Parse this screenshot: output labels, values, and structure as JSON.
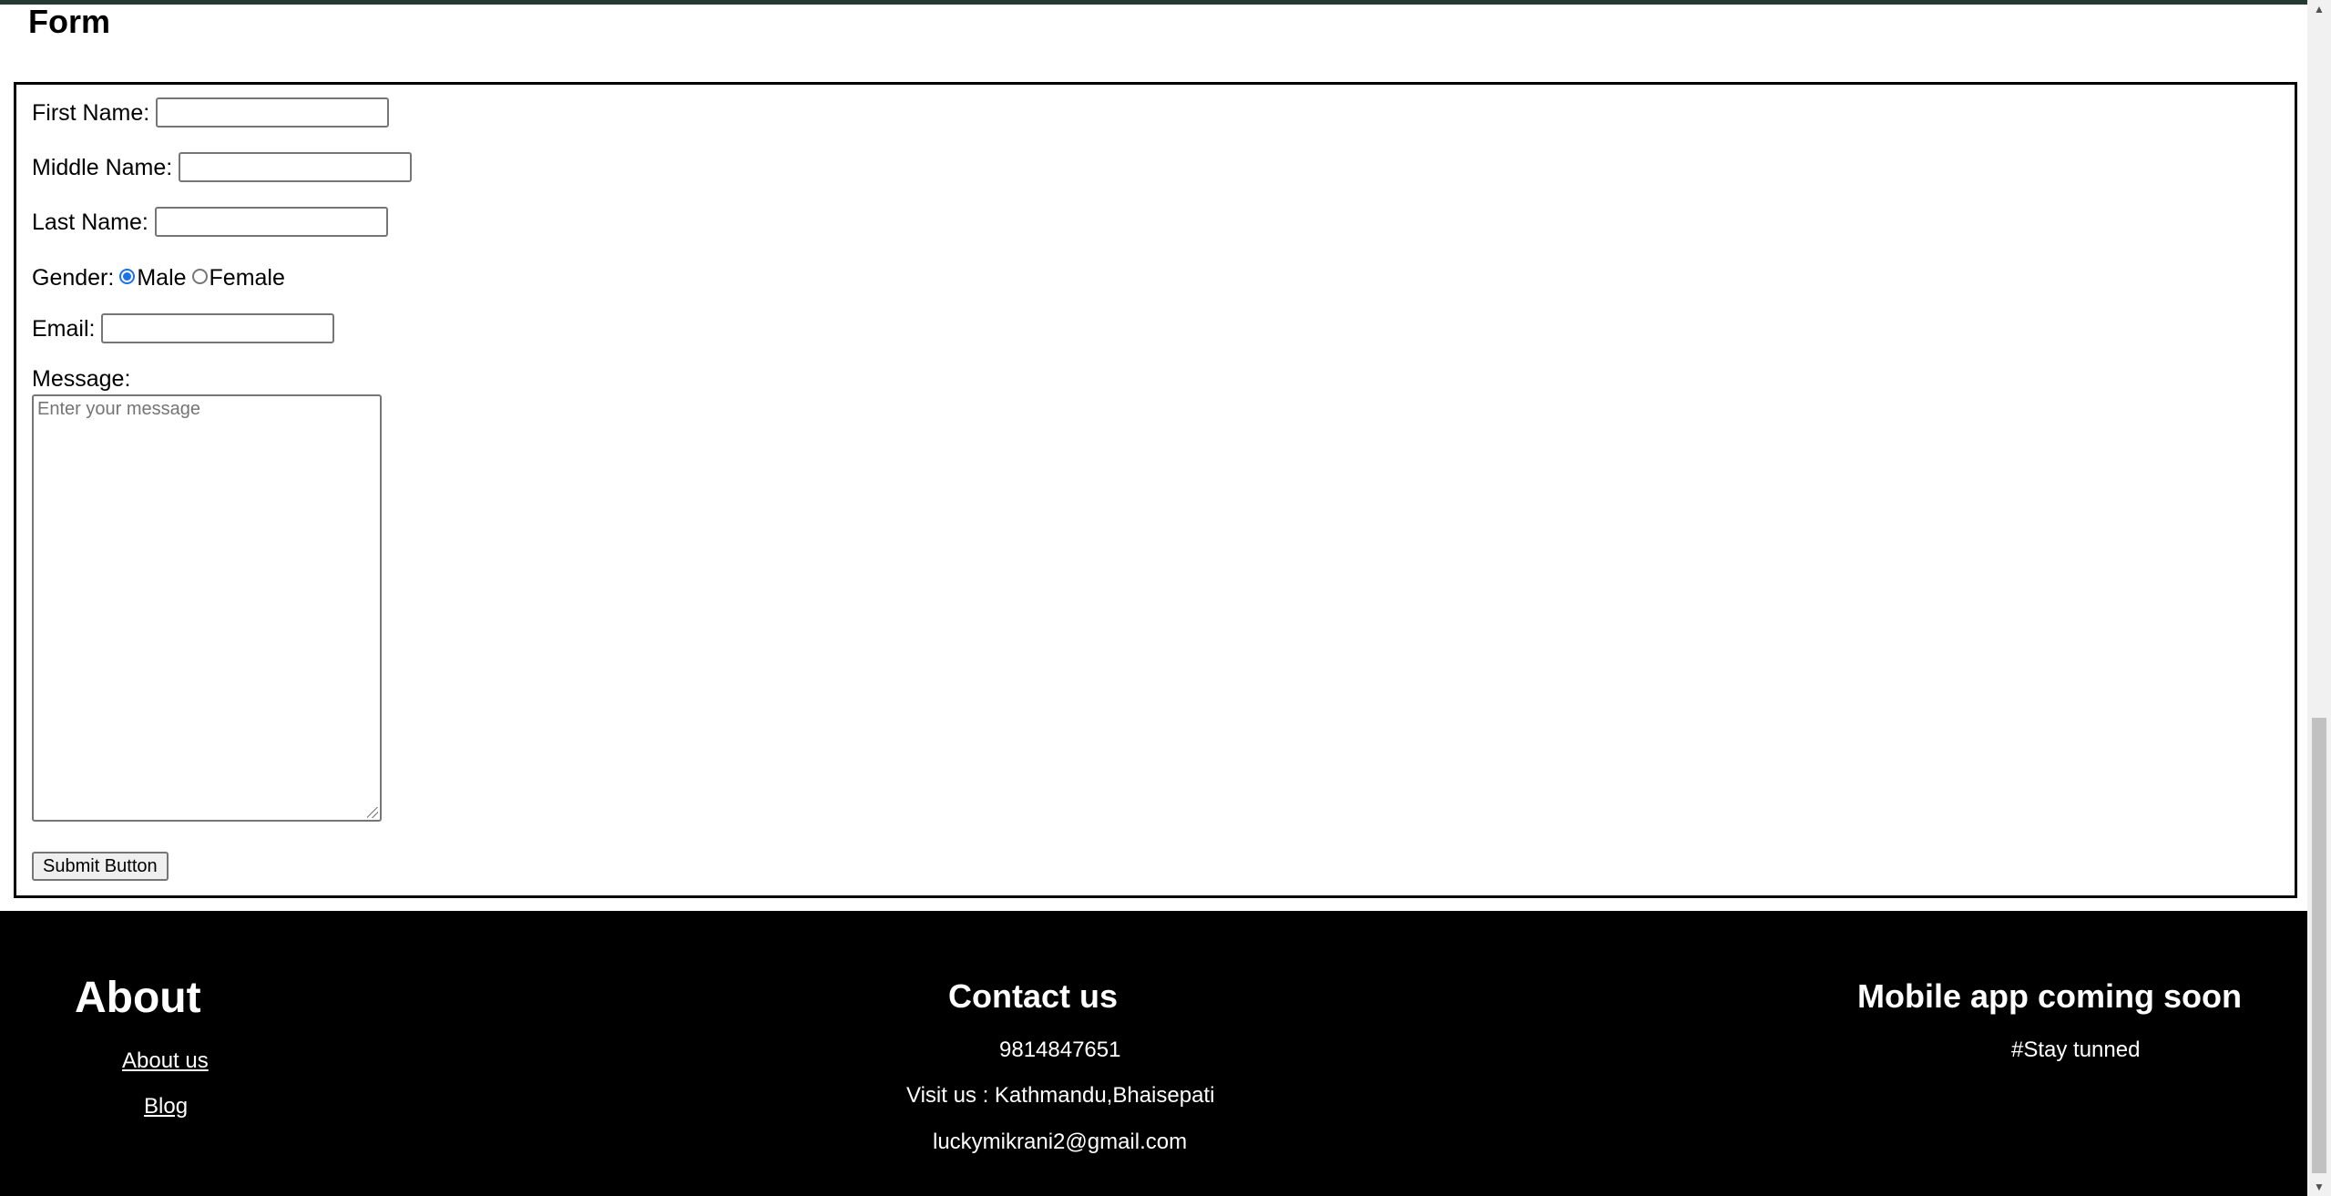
{
  "form": {
    "title": "Form",
    "first_name_label": "First Name:",
    "first_name_value": "",
    "middle_name_label": "Middle Name:",
    "middle_name_value": "",
    "last_name_label": "Last Name:",
    "last_name_value": "",
    "gender_label": "Gender:",
    "gender_options": [
      {
        "label": "Male",
        "selected": true
      },
      {
        "label": "Female",
        "selected": false
      }
    ],
    "email_label": "Email:",
    "email_value": "",
    "message_label": "Message:",
    "message_placeholder": "Enter your message",
    "submit_label": "Submit Button"
  },
  "footer": {
    "about": {
      "title": "About",
      "links": [
        "About us",
        "Blog"
      ]
    },
    "contact": {
      "title": "Contact us",
      "phone": "9814847651",
      "address": "Visit us : Kathmandu,Bhaisepati",
      "email": "luckymikrani2@gmail.com"
    },
    "app": {
      "title": "Mobile app coming soon",
      "tagline": "#Stay tunned"
    }
  },
  "colors": {
    "top_strip": "#263a33",
    "footer_bg": "#000000",
    "radio_accent": "#1a73e8"
  }
}
